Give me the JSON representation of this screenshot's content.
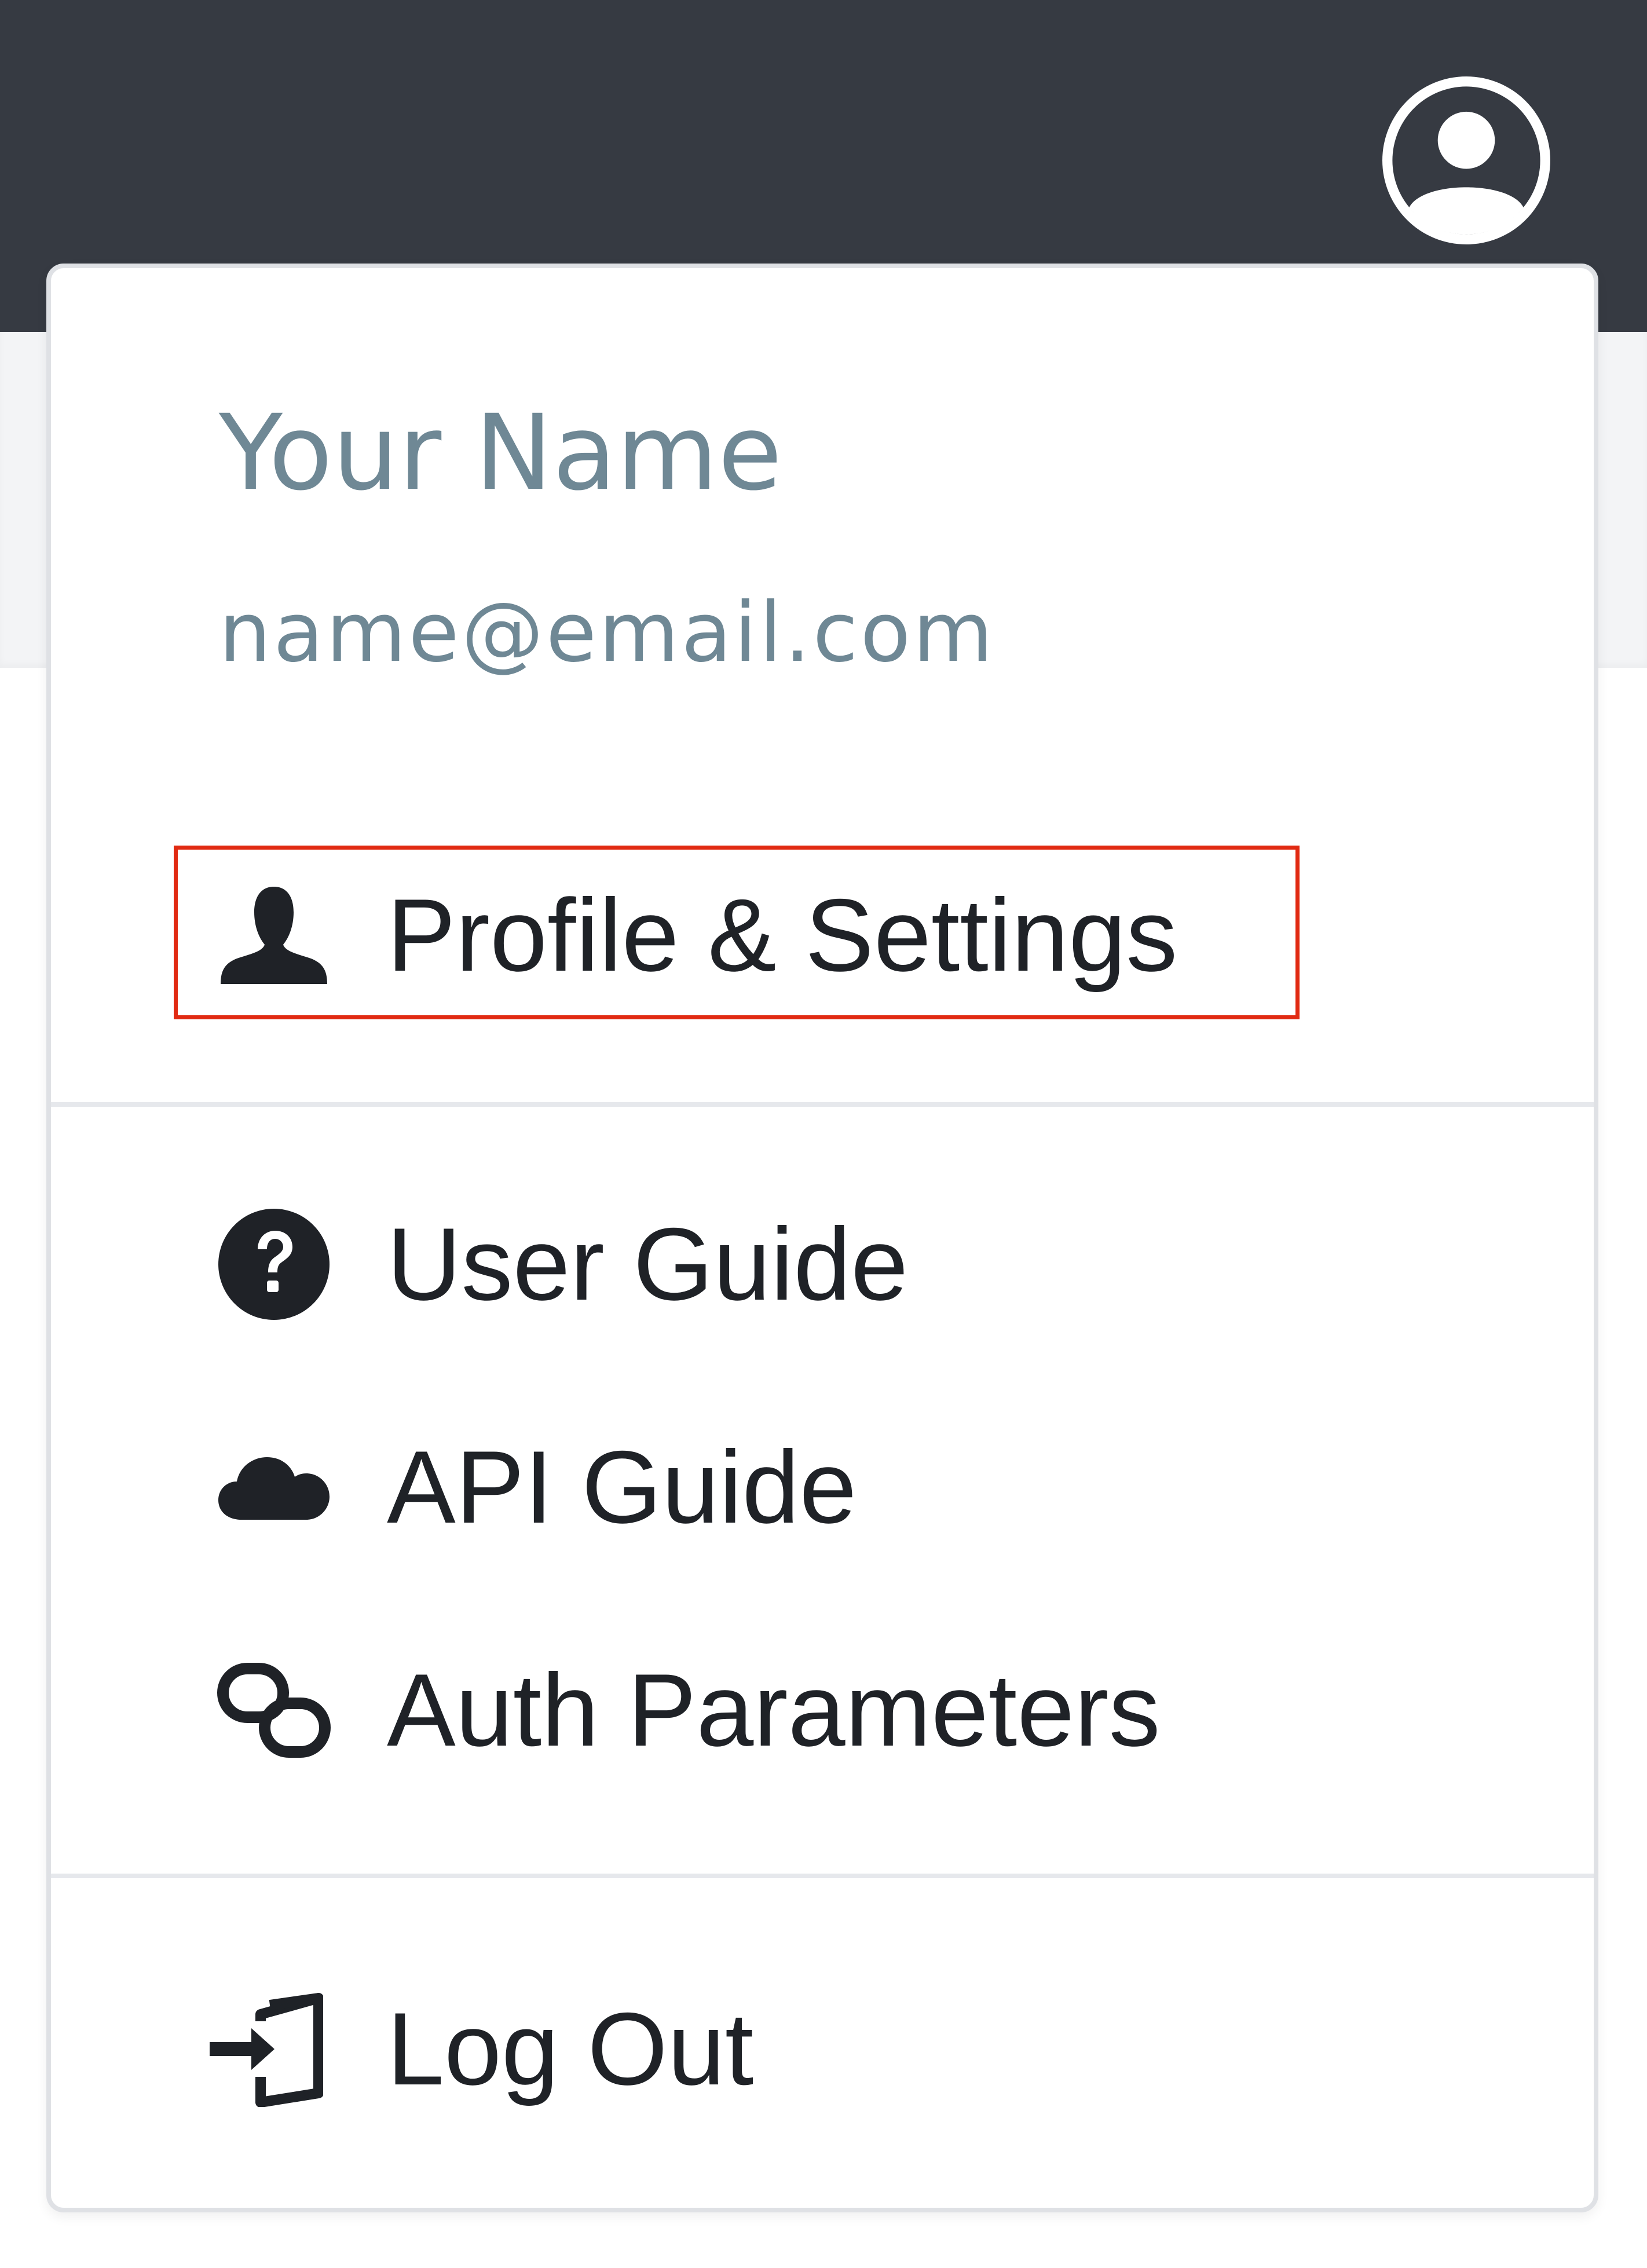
{
  "header": {
    "avatar_icon": "user-circle-icon",
    "background_color": "#363a42"
  },
  "dropdown": {
    "user": {
      "name": "Your Name",
      "email": "name@email.com"
    },
    "sections": [
      {
        "items": [
          {
            "label": "Profile & Settings",
            "icon": "user-silhouette-icon",
            "highlighted": true
          }
        ]
      },
      {
        "items": [
          {
            "label": "User Guide",
            "icon": "question-circle-icon"
          },
          {
            "label": "API Guide",
            "icon": "cloud-icon"
          },
          {
            "label": "Auth Parameters",
            "icon": "link-icon"
          }
        ]
      },
      {
        "items": [
          {
            "label": "Log Out",
            "icon": "log-out-icon"
          }
        ]
      }
    ],
    "highlight_color": "#e12a12",
    "text_color_muted": "#6f8895",
    "text_color": "#1f2227"
  }
}
